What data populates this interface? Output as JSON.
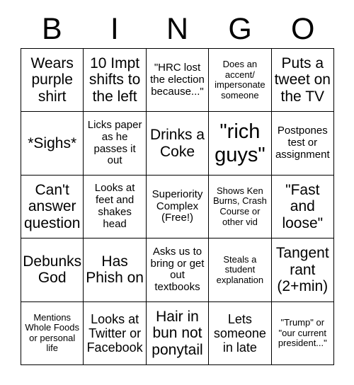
{
  "card": {
    "header_letters": [
      "B",
      "I",
      "N",
      "G",
      "O"
    ],
    "background_color": "#ffffff",
    "text_color": "#000000",
    "grid_line_color": "#000000",
    "rows": 5,
    "columns": 5,
    "cells": [
      [
        {
          "text": "Wears purple shirt",
          "size": "xl"
        },
        {
          "text": "10 Impt shifts to the left",
          "size": "xl"
        },
        {
          "text": "\"HRC lost the election because...\"",
          "size": "md"
        },
        {
          "text": "Does an accent/ impersonate someone",
          "size": "sm"
        },
        {
          "text": "Puts a tweet on the TV",
          "size": "xl"
        }
      ],
      [
        {
          "text": "*Sighs*",
          "size": "xl"
        },
        {
          "text": "Licks paper as he passes it out",
          "size": "md"
        },
        {
          "text": "Drinks a Coke",
          "size": "xl"
        },
        {
          "text": "\"rich guys\"",
          "size": "xxl"
        },
        {
          "text": "Postpones test or assignment",
          "size": "md"
        }
      ],
      [
        {
          "text": "Can't answer question",
          "size": "xl"
        },
        {
          "text": "Looks at feet and shakes head",
          "size": "md"
        },
        {
          "text": "Superiority Complex (Free!)",
          "size": "md"
        },
        {
          "text": "Shows Ken Burns, Crash Course or other vid",
          "size": "sm"
        },
        {
          "text": "\"Fast and loose\"",
          "size": "xl"
        }
      ],
      [
        {
          "text": "Debunks God",
          "size": "xl"
        },
        {
          "text": "Has Phish on",
          "size": "xl"
        },
        {
          "text": "Asks us to bring or get out textbooks",
          "size": "md"
        },
        {
          "text": "Steals a student explanation",
          "size": "sm"
        },
        {
          "text": "Tangent rant (2+min)",
          "size": "xl"
        }
      ],
      [
        {
          "text": "Mentions Whole Foods or personal life",
          "size": "sm"
        },
        {
          "text": "Looks at Twitter or Facebook",
          "size": "lg"
        },
        {
          "text": "Hair in bun not ponytail",
          "size": "xl"
        },
        {
          "text": "Lets someone in late",
          "size": "lg"
        },
        {
          "text": "\"Trump\" or \"our current president...\"",
          "size": "sm"
        }
      ]
    ]
  }
}
